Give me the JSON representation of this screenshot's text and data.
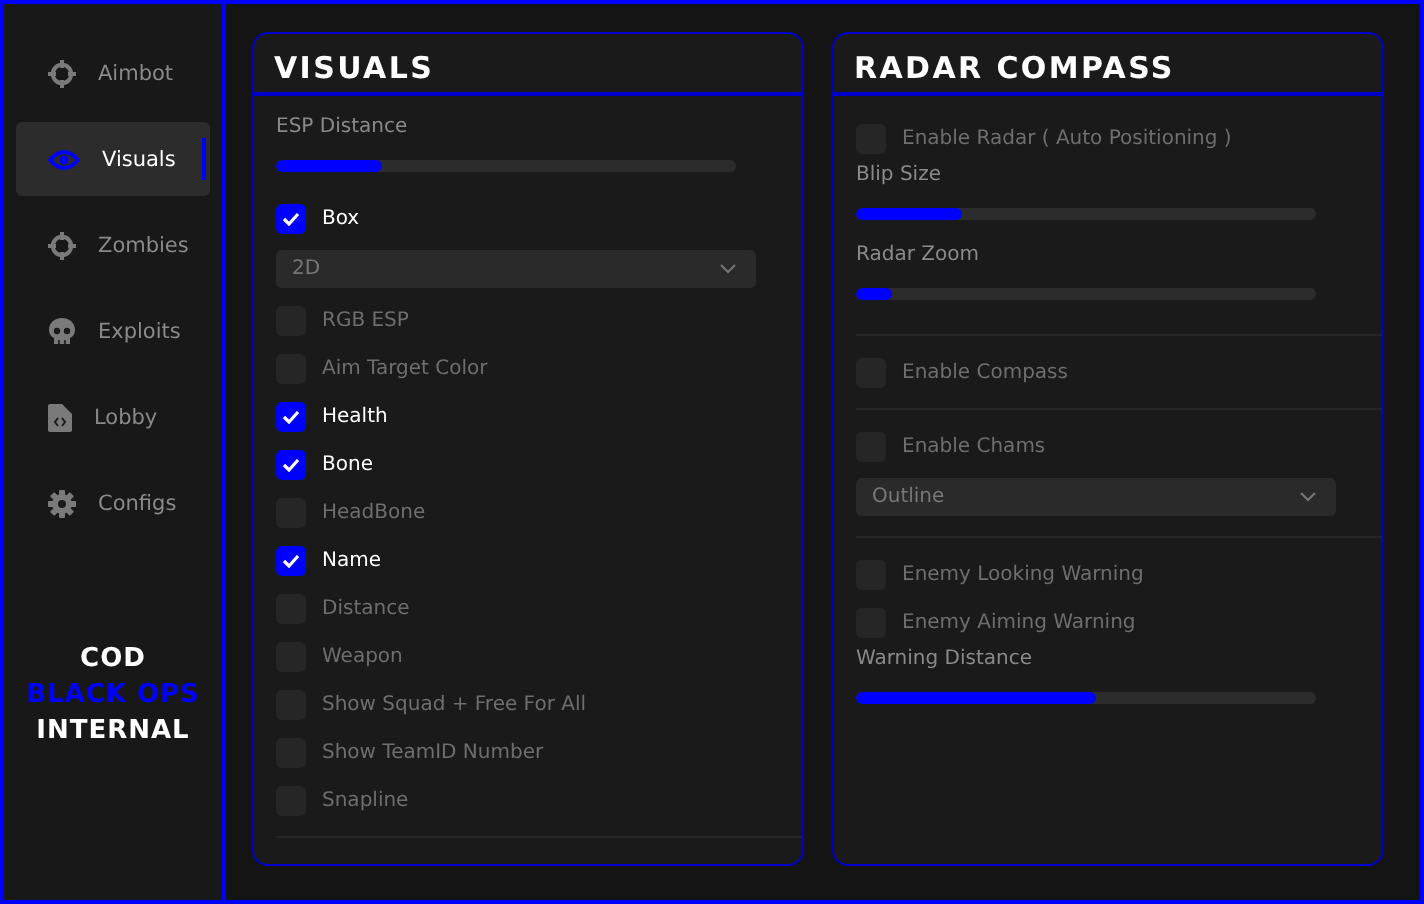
{
  "sidebar": {
    "items": [
      {
        "label": "Aimbot",
        "selected": false
      },
      {
        "label": "Visuals",
        "selected": true
      },
      {
        "label": "Zombies",
        "selected": false
      },
      {
        "label": "Exploits",
        "selected": false
      },
      {
        "label": "Lobby",
        "selected": false
      },
      {
        "label": "Configs",
        "selected": false
      }
    ],
    "logo": [
      "COD",
      "BLACK OPS",
      "INTERNAL"
    ]
  },
  "panels": [
    {
      "title": "VISUALS",
      "items": [
        {
          "kind": "slider",
          "label": "ESP Distance",
          "level": 0.23
        },
        {
          "kind": "checkbox",
          "label": "Box",
          "checked": true
        },
        {
          "kind": "dropdown",
          "value": "2D"
        },
        {
          "kind": "checkbox",
          "label": "RGB ESP",
          "checked": false
        },
        {
          "kind": "checkbox",
          "label": "Aim Target Color",
          "checked": false
        },
        {
          "kind": "checkbox",
          "label": "Health",
          "checked": true
        },
        {
          "kind": "checkbox",
          "label": "Bone",
          "checked": true
        },
        {
          "kind": "checkbox",
          "label": "HeadBone",
          "checked": false
        },
        {
          "kind": "checkbox",
          "label": "Name",
          "checked": true
        },
        {
          "kind": "checkbox",
          "label": "Distance",
          "checked": false
        },
        {
          "kind": "checkbox",
          "label": "Weapon",
          "checked": false
        },
        {
          "kind": "checkbox",
          "label": "Show Squad + Free For All",
          "checked": false
        },
        {
          "kind": "checkbox",
          "label": "Show TeamID Number",
          "checked": false
        },
        {
          "kind": "checkbox",
          "label": "Snapline",
          "checked": false
        },
        {
          "kind": "divider"
        }
      ]
    },
    {
      "title": "RADAR COMPASS",
      "items": [
        {
          "kind": "checkbox",
          "label": "Enable Radar ( Auto Positioning )",
          "checked": false
        },
        {
          "kind": "slider",
          "label": "Blip Size",
          "level": 0.23
        },
        {
          "kind": "slider",
          "label": "Radar Zoom",
          "level": 0.08
        },
        {
          "kind": "divider"
        },
        {
          "kind": "checkbox",
          "label": "Enable Compass",
          "checked": false
        },
        {
          "kind": "divider"
        },
        {
          "kind": "checkbox",
          "label": "Enable Chams",
          "checked": false
        },
        {
          "kind": "dropdown",
          "value": "Outline"
        },
        {
          "kind": "divider"
        },
        {
          "kind": "checkbox",
          "label": "Enemy Looking Warning",
          "checked": false
        },
        {
          "kind": "checkbox",
          "label": "Enemy Aiming Warning",
          "checked": false
        },
        {
          "kind": "slider",
          "label": "Warning Distance",
          "level": 0.52
        }
      ]
    }
  ]
}
